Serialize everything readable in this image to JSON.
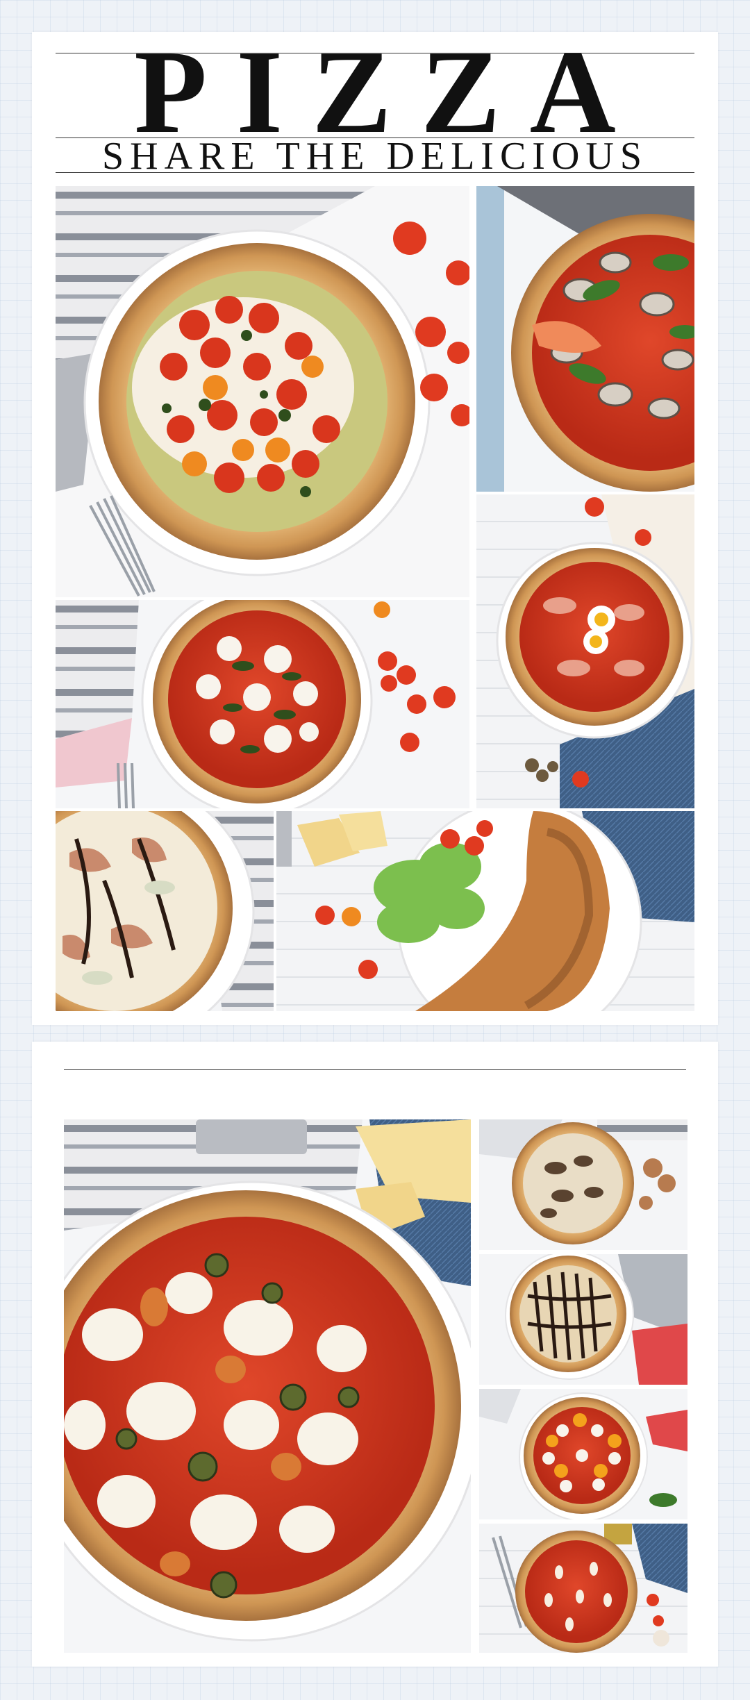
{
  "header": {
    "title": "PIZZA",
    "subtitle": "SHARE THE DELICIOUS"
  },
  "photos": [
    "margherita-cherry-tomato-pesto-pizza",
    "seafood-clam-shrimp-pizza",
    "bufala-basil-pizza",
    "egg-ham-pizza",
    "prosciutto-pear-balsamic-pizza",
    "calzone-with-salad",
    "margherita-olive-pepper-pizza",
    "mushroom-pizza",
    "balsamic-white-pizza",
    "mozzarella-tomato-pizza",
    "marinara-garlic-pizza"
  ],
  "colors": {
    "background": "#eef2f7",
    "card": "#ffffff",
    "text": "#111111",
    "sauce": "#c9321b",
    "crust": "#d9a766",
    "cheese": "#f6efe2"
  }
}
